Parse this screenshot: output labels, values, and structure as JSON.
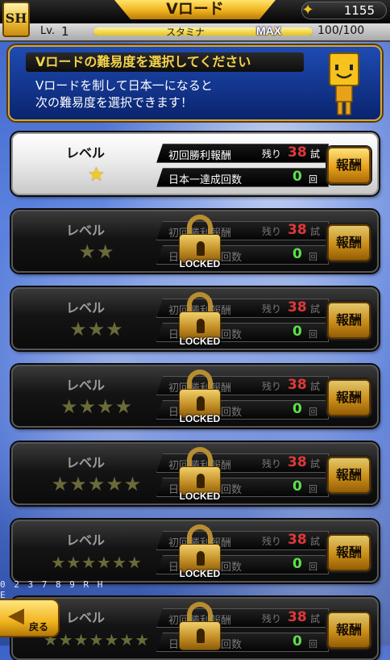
{
  "header": {
    "logo_text": "SH",
    "title": "Vロード",
    "coins": "1155"
  },
  "status": {
    "level_label": "Lv.",
    "level_value": "1",
    "stamina_label": "スタミナ",
    "max_label": "MAX",
    "stamina_value": "100/100",
    "stamina_fraction": 1.0
  },
  "intro": {
    "title": "Vロードの難易度を選択してください",
    "line1": "Vロードを制して日本一になると",
    "line2": "次の難易度を選択できます！"
  },
  "levels": [
    {
      "label": "レベル",
      "stars": 1,
      "first_win_label": "初回勝利報酬",
      "remaining_label": "残り",
      "remaining": "38",
      "games_label": "試合",
      "count_label": "日本一達成回数",
      "count": "0",
      "times_label": "回",
      "reward_label": "報酬",
      "locked": false,
      "lock_text": ""
    },
    {
      "label": "レベル",
      "stars": 2,
      "first_win_label": "初回勝利報酬",
      "remaining_label": "残り",
      "remaining": "38",
      "games_label": "試合",
      "count_label": "日本一達成回数",
      "count": "0",
      "times_label": "回",
      "reward_label": "報酬",
      "locked": true,
      "lock_text": "LOCKED"
    },
    {
      "label": "レベル",
      "stars": 3,
      "first_win_label": "初回勝利報酬",
      "remaining_label": "残り",
      "remaining": "38",
      "games_label": "試合",
      "count_label": "日本一達成回数",
      "count": "0",
      "times_label": "回",
      "reward_label": "報酬",
      "locked": true,
      "lock_text": "LOCKED"
    },
    {
      "label": "レベル",
      "stars": 4,
      "first_win_label": "初回勝利報酬",
      "remaining_label": "残り",
      "remaining": "38",
      "games_label": "試合",
      "count_label": "日本一達成回数",
      "count": "0",
      "times_label": "回",
      "reward_label": "報酬",
      "locked": true,
      "lock_text": "LOCKED"
    },
    {
      "label": "レベル",
      "stars": 5,
      "first_win_label": "初回勝利報酬",
      "remaining_label": "残り",
      "remaining": "38",
      "games_label": "試合",
      "count_label": "日本一達成回数",
      "count": "0",
      "times_label": "回",
      "reward_label": "報酬",
      "locked": true,
      "lock_text": "LOCKED"
    },
    {
      "label": "レベル",
      "stars": 6,
      "first_win_label": "初回勝利報酬",
      "remaining_label": "残り",
      "remaining": "38",
      "games_label": "試合",
      "count_label": "日本一達成回数",
      "count": "0",
      "times_label": "回",
      "reward_label": "報酬",
      "locked": true,
      "lock_text": "LOCKED"
    },
    {
      "label": "レベル",
      "stars": 7,
      "first_win_label": "初回勝利報酬",
      "remaining_label": "残り",
      "remaining": "38",
      "games_label": "試合",
      "count_label": "日本一達成回数",
      "count": "0",
      "times_label": "回",
      "reward_label": "報酬",
      "locked": true,
      "lock_text": ""
    }
  ],
  "background": {
    "scoreboard_text": "0 2 3 7 8 9 R H E"
  },
  "footer": {
    "back_label": "戻る"
  },
  "colors": {
    "accent_gold": "#f0b21c",
    "remaining_red": "#e03838",
    "count_green": "#5ce04a",
    "title_yellow": "#f4d24a"
  }
}
